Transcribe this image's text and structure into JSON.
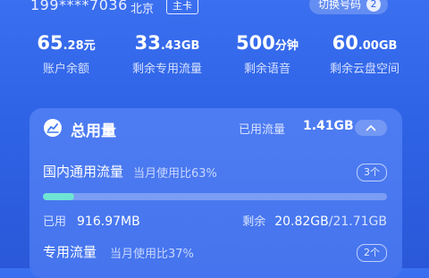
{
  "account": {
    "phone": "199****7036",
    "region": "北京",
    "tag": "主卡",
    "switch_label": "切换号码",
    "switch_count": "2"
  },
  "stats": [
    {
      "value_big": "65",
      "value_small": ".28元",
      "label": "账户余额"
    },
    {
      "value_big": "33",
      "value_small": ".43GB",
      "label": "剩余专用流量"
    },
    {
      "value_big": "500",
      "value_small": "分钟",
      "label": "剩余语音"
    },
    {
      "value_big": "60",
      "value_small": ".00GB",
      "label": "剩余云盘空间"
    }
  ],
  "usage": {
    "title": "总用量",
    "used_label": "已用流量",
    "used_value": "1.41GB",
    "domestic": {
      "title": "国内通用流量",
      "ratio_text": "当月使用比63%",
      "count": "3个",
      "progress": 0.09,
      "used_label": "已用",
      "used_value": "916.97MB",
      "remain_label": "剩余",
      "remain_value": "20.82GB",
      "total_value": "/21.71GB"
    },
    "dedicated": {
      "title": "专用流量",
      "ratio_text": "当月使用比37%",
      "count": "2个"
    }
  },
  "colors": {
    "background": "#2f63e6",
    "card": "#4a78f0",
    "progress_fill": "#6fe3d4"
  },
  "icons": {
    "total_usage": "cloud-chart-icon",
    "collapse": "chevron-up-icon"
  }
}
